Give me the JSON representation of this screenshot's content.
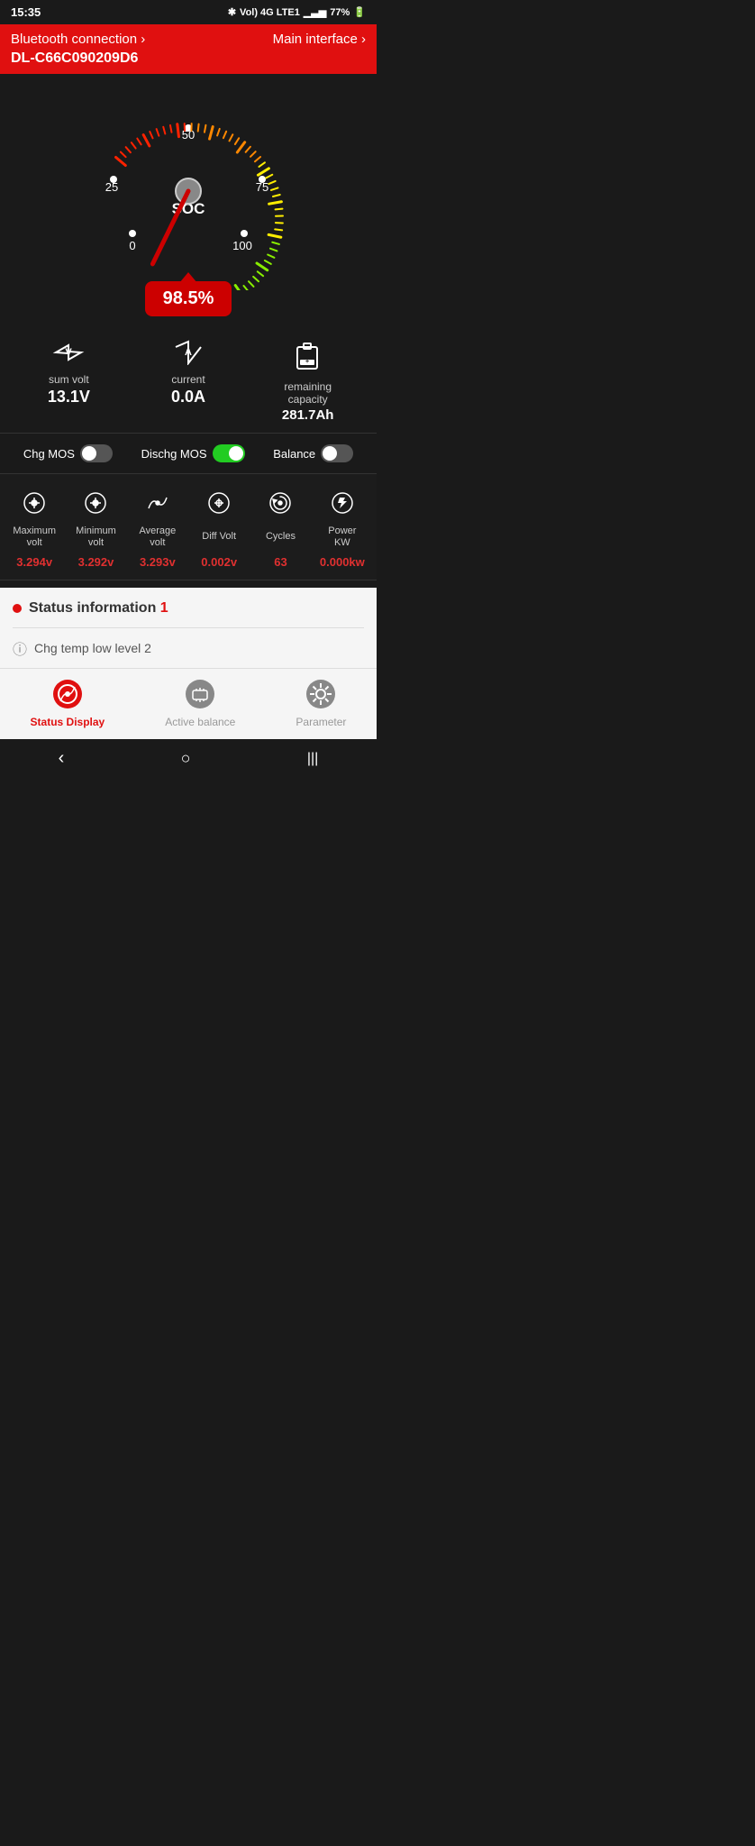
{
  "statusBar": {
    "time": "15:35",
    "battery": "77%",
    "signal": "VoLTE 4G"
  },
  "header": {
    "bluetooth": "Bluetooth connection",
    "mainInterface": "Main interface",
    "deviceId": "DL-C66C090209D6"
  },
  "gauge": {
    "socLabel": "SOC",
    "percentage": "98.5%",
    "markers": [
      "0",
      "25",
      "50",
      "75",
      "100"
    ]
  },
  "stats": {
    "sumVolt": {
      "label": "sum volt",
      "value": "13.1V",
      "icon": "V"
    },
    "current": {
      "label": "current",
      "value": "0.0A",
      "icon": "A"
    },
    "remaining": {
      "label": "remaining\ncapacity",
      "value": "281.7Ah"
    }
  },
  "mosRow": {
    "chgMos": "Chg MOS",
    "dischgMos": "Dischg MOS",
    "balance": "Balance",
    "chgMosState": false,
    "dischgMosState": true,
    "balanceState": false
  },
  "bottomStats": {
    "items": [
      {
        "label": "Maximum volt",
        "value": "3.294v"
      },
      {
        "label": "Minimum volt",
        "value": "3.292v"
      },
      {
        "label": "Average volt",
        "value": "3.293v"
      },
      {
        "label": "Diff Volt",
        "value": "0.002v"
      },
      {
        "label": "Cycles",
        "value": "63"
      },
      {
        "label": "Power KW",
        "value": "0.000kw"
      }
    ]
  },
  "statusInfo": {
    "title": "Status information",
    "count": "1",
    "items": [
      {
        "text": "Chg temp low level 2"
      }
    ]
  },
  "bottomNav": {
    "items": [
      {
        "label": "Status Display",
        "active": true
      },
      {
        "label": "Active balance",
        "active": false
      },
      {
        "label": "Parameter",
        "active": false
      }
    ]
  }
}
